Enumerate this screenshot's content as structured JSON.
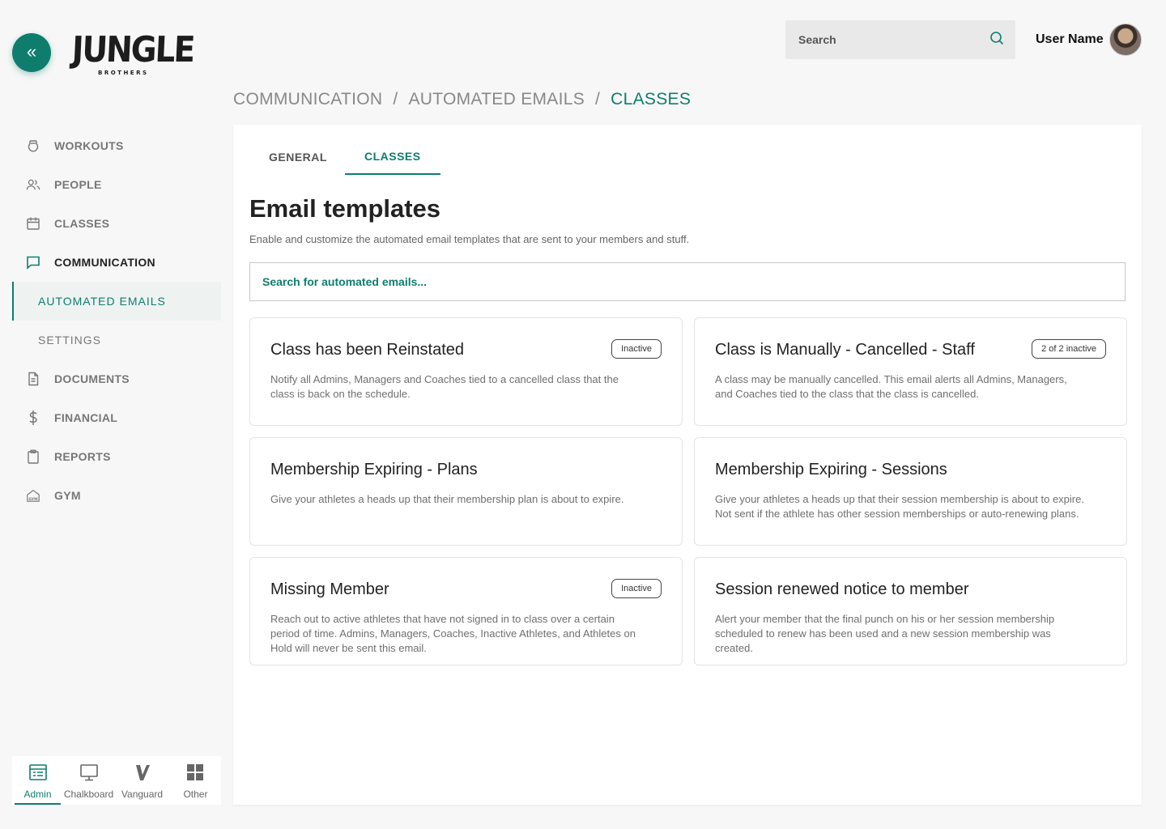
{
  "brand": {
    "name": "JUNGLE",
    "sub": "BROTHERS",
    "accent": "#0e7d6e"
  },
  "header": {
    "search_placeholder": "Search",
    "user_name": "User Name"
  },
  "nav": {
    "items": [
      {
        "label": "WORKOUTS",
        "icon": "kettlebell-icon"
      },
      {
        "label": "PEOPLE",
        "icon": "people-icon"
      },
      {
        "label": "CLASSES",
        "icon": "calendar-icon"
      },
      {
        "label": "COMMUNICATION",
        "icon": "chat-icon"
      },
      {
        "label": "DOCUMENTS",
        "icon": "document-icon"
      },
      {
        "label": "FINANCIAL",
        "icon": "dollar-icon"
      },
      {
        "label": "REPORTS",
        "icon": "clipboard-icon"
      },
      {
        "label": "GYM",
        "icon": "gym-icon"
      }
    ],
    "sub_items": [
      {
        "label": "AUTOMATED EMAILS"
      },
      {
        "label": "SETTINGS"
      }
    ]
  },
  "app_switcher": [
    {
      "label": "Admin",
      "icon": "admin-icon"
    },
    {
      "label": "Chalkboard",
      "icon": "chalkboard-icon"
    },
    {
      "label": "Vanguard",
      "icon": "vanguard-icon"
    },
    {
      "label": "Other",
      "icon": "grid-icon"
    }
  ],
  "breadcrumb": [
    "COMMUNICATION",
    "AUTOMATED EMAILS",
    "CLASSES"
  ],
  "tabs": [
    "GENERAL",
    "CLASSES"
  ],
  "main": {
    "title": "Email templates",
    "subtitle": "Enable and customize the automated email templates that are sent to your members and stuff.",
    "search_placeholder": "Search for automated emails..."
  },
  "cards": [
    {
      "title": "Class has been Reinstated",
      "desc": "Notify all Admins, Managers and Coaches tied to a cancelled class that the class is back on the schedule.",
      "badge": "Inactive"
    },
    {
      "title": "Class is Manually - Cancelled - Staff",
      "desc": "A class may be manually cancelled. This email alerts all Admins, Managers, and Coaches tied to the class that the class is cancelled.",
      "badge": "2 of 2 inactive"
    },
    {
      "title": "Membership Expiring - Plans",
      "desc": "Give your athletes a heads up that their membership plan is about to expire.",
      "badge": ""
    },
    {
      "title": "Membership Expiring - Sessions",
      "desc": "Give your athletes a heads up that their session membership is about to expire. Not sent if the athlete has other session memberships or auto-renewing plans.",
      "badge": ""
    },
    {
      "title": "Missing Member",
      "desc": "Reach out to active athletes that have not signed in to class over a certain period of time. Admins, Managers, Coaches, Inactive Athletes, and Athletes on Hold will never be sent this email.",
      "badge": "Inactive"
    },
    {
      "title": "Session renewed notice to member",
      "desc": "Alert your member that the final punch on his or her session membership scheduled to renew has been used and a new session membership was created.",
      "badge": ""
    }
  ]
}
